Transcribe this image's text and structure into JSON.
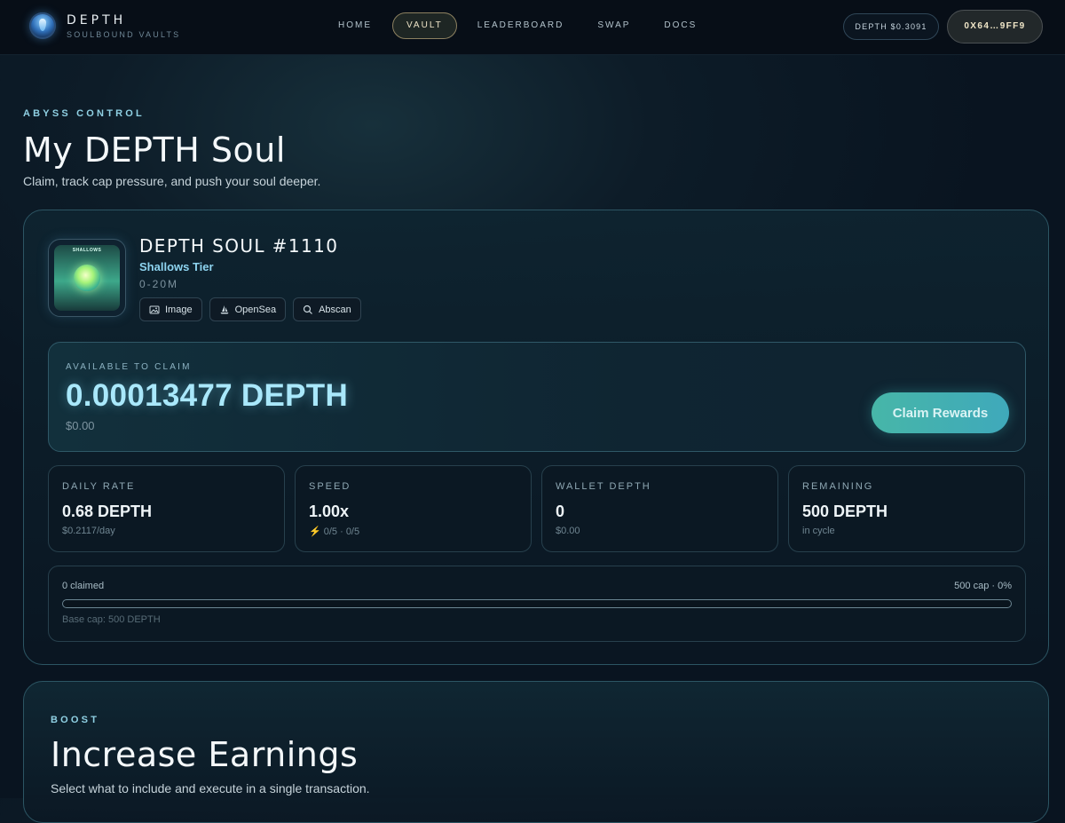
{
  "brand": {
    "name": "DEPTH",
    "tagline": "SOULBOUND VAULTS",
    "logo_icon": "depth-orb-icon"
  },
  "nav": {
    "items": [
      {
        "label": "HOME",
        "active": false
      },
      {
        "label": "VAULT",
        "active": true
      },
      {
        "label": "LEADERBOARD",
        "active": false
      },
      {
        "label": "SWAP",
        "active": false
      },
      {
        "label": "DOCS",
        "active": false
      }
    ],
    "price": "DEPTH $0.3091",
    "wallet": "0X64…9FF9"
  },
  "page": {
    "eyebrow": "ABYSS CONTROL",
    "title": "My DEPTH Soul",
    "subtitle": "Claim, track cap pressure, and push your soul deeper."
  },
  "soul": {
    "thumb_label": "SHALLOWS",
    "name": "DEPTH SOUL #1110",
    "tier": "Shallows Tier",
    "range": "0-20M",
    "links": [
      {
        "label": "Image",
        "icon": "image-icon"
      },
      {
        "label": "OpenSea",
        "icon": "sailboat-icon"
      },
      {
        "label": "Abscan",
        "icon": "search-icon"
      }
    ]
  },
  "claim": {
    "label": "AVAILABLE TO CLAIM",
    "amount": "0.00013477 DEPTH",
    "usd": "$0.00",
    "button": "Claim Rewards"
  },
  "stats": [
    {
      "label": "DAILY RATE",
      "value": "0.68 DEPTH",
      "sub": "$0.2117/day"
    },
    {
      "label": "SPEED",
      "value": "1.00x",
      "sub": "⚡ 0/5 · 0/5"
    },
    {
      "label": "WALLET DEPTH",
      "value": "0",
      "sub": "$0.00"
    },
    {
      "label": "REMAINING",
      "value": "500 DEPTH",
      "sub": "in cycle"
    }
  ],
  "progress": {
    "left": "0 claimed",
    "right": "500 cap · 0%",
    "fraction": 0,
    "footer": "Base cap: 500 DEPTH"
  },
  "boost": {
    "eyebrow": "BOOST",
    "title": "Increase Earnings",
    "subtitle": "Select what to include and execute in a single transaction."
  },
  "colors": {
    "accent": "#47b6a8",
    "claim_text": "#a9e8fb",
    "border": "#2c5563",
    "background": "#0d1c28"
  }
}
